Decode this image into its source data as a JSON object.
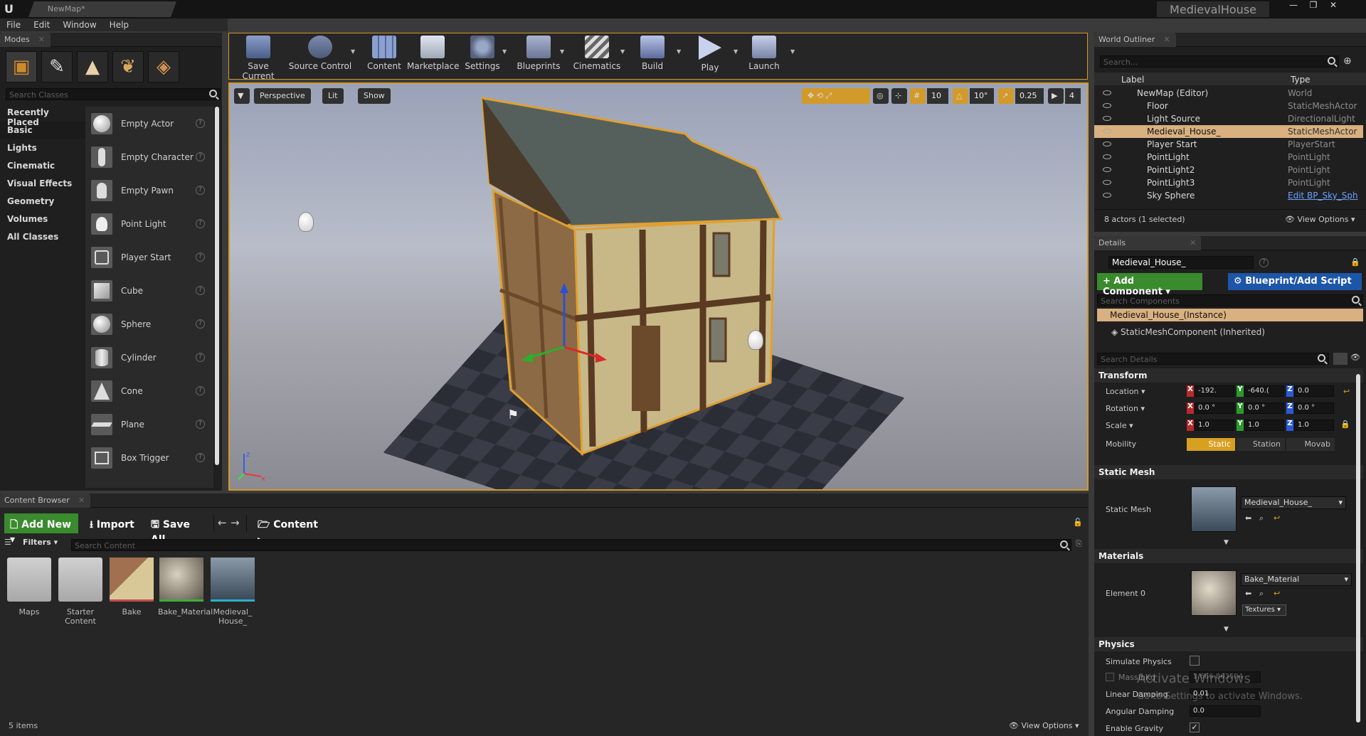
{
  "window": {
    "doc_tab": "NewMap*",
    "project": "MedievalHouse"
  },
  "menu": [
    "File",
    "Edit",
    "Window",
    "Help"
  ],
  "modes": {
    "tab": "Modes",
    "search_placeholder": "Search Classes",
    "categories": [
      "Recently Placed",
      "Basic",
      "Lights",
      "Cinematic",
      "Visual Effects",
      "Geometry",
      "Volumes",
      "All Classes"
    ],
    "selected_category": "Basic",
    "items": [
      "Empty Actor",
      "Empty Character",
      "Empty Pawn",
      "Point Light",
      "Player Start",
      "Cube",
      "Sphere",
      "Cylinder",
      "Cone",
      "Plane",
      "Box Trigger"
    ]
  },
  "toolbar": [
    {
      "label": "Save Current",
      "icon": "save-icon"
    },
    {
      "label": "Source Control",
      "icon": "source-control-icon"
    },
    {
      "label": "Content",
      "icon": "content-icon"
    },
    {
      "label": "Marketplace",
      "icon": "marketplace-icon"
    },
    {
      "label": "Settings",
      "icon": "settings-icon"
    },
    {
      "label": "Blueprints",
      "icon": "blueprints-icon"
    },
    {
      "label": "Cinematics",
      "icon": "cinematics-icon"
    },
    {
      "label": "Build",
      "icon": "build-icon"
    },
    {
      "label": "Play",
      "icon": "play-icon"
    },
    {
      "label": "Launch",
      "icon": "launch-icon"
    }
  ],
  "viewport": {
    "perspective": "Perspective",
    "lit": "Lit",
    "show": "Show",
    "grid_snap": "10",
    "rot_snap": "10°",
    "scale_snap": "0.25",
    "cam_speed": "4"
  },
  "outliner": {
    "tab": "World Outliner",
    "search_placeholder": "Search...",
    "col_label": "Label",
    "col_type": "Type",
    "rows": [
      {
        "label": "NewMap (Editor)",
        "type": "World"
      },
      {
        "label": "Floor",
        "type": "StaticMeshActor"
      },
      {
        "label": "Light Source",
        "type": "DirectionalLight"
      },
      {
        "label": "Medieval_House_",
        "type": "StaticMeshActor"
      },
      {
        "label": "Player Start",
        "type": "PlayerStart"
      },
      {
        "label": "PointLight",
        "type": "PointLight"
      },
      {
        "label": "PointLight2",
        "type": "PointLight"
      },
      {
        "label": "PointLight3",
        "type": "PointLight"
      },
      {
        "label": "Sky Sphere",
        "type": "Edit BP_Sky_Sph"
      }
    ],
    "status": "8 actors (1 selected)",
    "view_options": "View Options"
  },
  "details": {
    "tab": "Details",
    "name": "Medieval_House_",
    "add_component": "+ Add Component",
    "blueprint": "Blueprint/Add Script",
    "search_components": "Search Components",
    "instance": "Medieval_House_(Instance)",
    "component": "StaticMeshComponent (Inherited)",
    "search_details": "Search Details",
    "transform": {
      "title": "Transform",
      "location_label": "Location",
      "rotation_label": "Rotation",
      "scale_label": "Scale",
      "mobility_label": "Mobility",
      "location": [
        "-192.",
        "-640.(",
        "0.0"
      ],
      "rotation": [
        "0.0 °",
        "0.0 °",
        "0.0 °"
      ],
      "scale": [
        "1.0",
        "1.0",
        "1.0"
      ],
      "mobility": [
        "Static",
        "Station",
        "Movab"
      ]
    },
    "static_mesh": {
      "title": "Static Mesh",
      "label": "Static Mesh",
      "value": "Medieval_House_"
    },
    "materials": {
      "title": "Materials",
      "label": "Element 0",
      "value": "Bake_Material",
      "textures": "Textures"
    },
    "physics": {
      "title": "Physics",
      "simulate": "Simulate Physics",
      "mass": "MassInKg",
      "mass_value": "3.666.863594",
      "linear": "Linear Damping",
      "linear_value": "0.01",
      "angular": "Angular Damping",
      "angular_value": "0.0",
      "gravity": "Enable Gravity"
    }
  },
  "content_browser": {
    "tab": "Content Browser",
    "add_new": "Add New",
    "import": "Import",
    "save_all": "Save All",
    "path": "Content",
    "filters": "Filters",
    "search_placeholder": "Search Content",
    "assets": [
      {
        "label": "Maps"
      },
      {
        "label": "Starter Content"
      },
      {
        "label": "Bake"
      },
      {
        "label": "Bake_Material"
      },
      {
        "label": "Medieval_ House_"
      }
    ],
    "count": "5 items",
    "view_options": "View Options"
  },
  "watermark": {
    "line1": "Activate Windows",
    "line2": "Go to Settings to activate Windows."
  }
}
